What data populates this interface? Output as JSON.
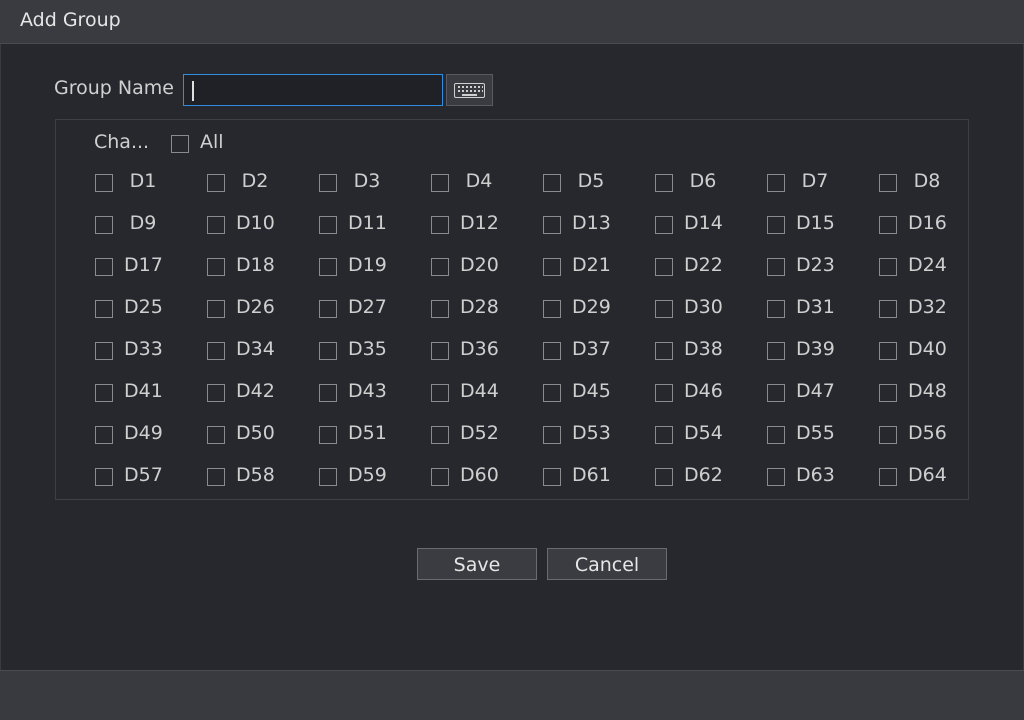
{
  "window": {
    "title": "Add Group"
  },
  "group_name": {
    "label": "Group Name",
    "value": "",
    "keyboard_icon": "keyboard-icon"
  },
  "channels": {
    "header": "Cha...",
    "all_label": "All",
    "items": [
      "D1",
      "D2",
      "D3",
      "D4",
      "D5",
      "D6",
      "D7",
      "D8",
      "D9",
      "D10",
      "D11",
      "D12",
      "D13",
      "D14",
      "D15",
      "D16",
      "D17",
      "D18",
      "D19",
      "D20",
      "D21",
      "D22",
      "D23",
      "D24",
      "D25",
      "D26",
      "D27",
      "D28",
      "D29",
      "D30",
      "D31",
      "D32",
      "D33",
      "D34",
      "D35",
      "D36",
      "D37",
      "D38",
      "D39",
      "D40",
      "D41",
      "D42",
      "D43",
      "D44",
      "D45",
      "D46",
      "D47",
      "D48",
      "D49",
      "D50",
      "D51",
      "D52",
      "D53",
      "D54",
      "D55",
      "D56",
      "D57",
      "D58",
      "D59",
      "D60",
      "D61",
      "D62",
      "D63",
      "D64"
    ]
  },
  "buttons": {
    "save": "Save",
    "cancel": "Cancel"
  },
  "colors": {
    "accent": "#2f8ee0",
    "background": "#27282d",
    "titlebar": "#3a3b40"
  }
}
